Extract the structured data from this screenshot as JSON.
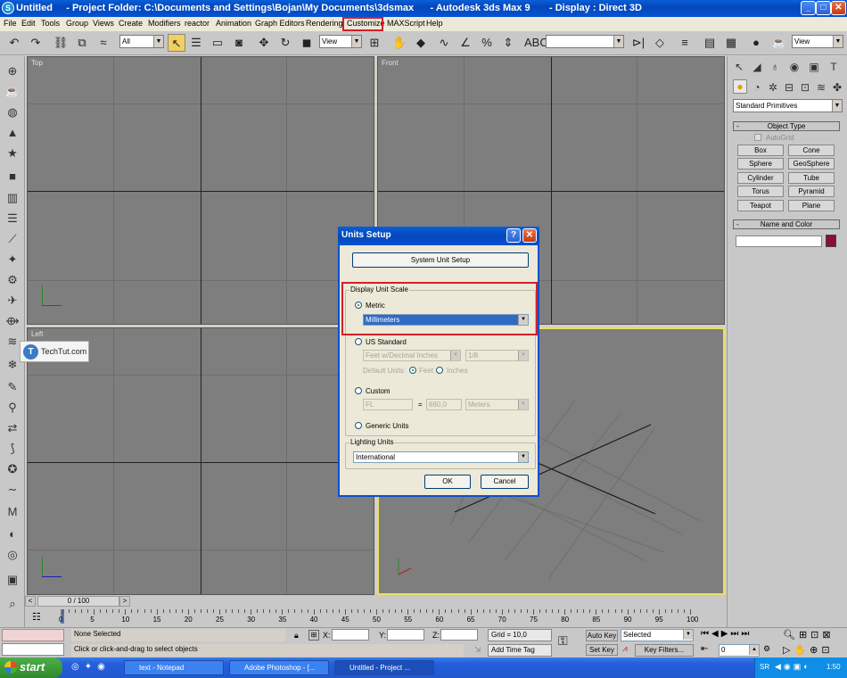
{
  "window": {
    "title": "Untitled     - Project Folder: C:\\Documents and Settings\\Bojan\\My Documents\\3dsmax      - Autodesk 3ds Max 9       - Display : Direct 3D",
    "controls": [
      "_",
      "□",
      "✕"
    ]
  },
  "menu": {
    "items": [
      "File",
      "Edit",
      "Tools",
      "Group",
      "Views",
      "Create",
      "Modifiers",
      "reactor",
      "Animation",
      "Graph Editors",
      "Rendering",
      "Customize",
      "MAXScript",
      "Help"
    ],
    "highlighted": "Customize"
  },
  "toolbar": {
    "selection_filter": "All",
    "ref_coord": "View",
    "named_sel": "",
    "view_right": "View"
  },
  "viewports": {
    "top": "Top",
    "front": "Front",
    "left": "Left",
    "perspective": "Perspective"
  },
  "watermark": {
    "text": "TechTut.com"
  },
  "command_panel": {
    "category": "Standard Primitives",
    "object_type_title": "Object Type",
    "autogrid": "AutoGrid",
    "buttons": [
      "Box",
      "Cone",
      "Sphere",
      "GeoSphere",
      "Cylinder",
      "Tube",
      "Torus",
      "Pyramid",
      "Teapot",
      "Plane"
    ],
    "name_color_title": "Name and Color",
    "swatch_color": "#8b1030"
  },
  "timeline": {
    "frame": "0 / 100",
    "ticks": [
      "0",
      "5",
      "10",
      "15",
      "20",
      "25",
      "30",
      "35",
      "40",
      "45",
      "50",
      "55",
      "60",
      "65",
      "70",
      "75",
      "80",
      "85",
      "90",
      "95",
      "100"
    ]
  },
  "status": {
    "selection": "None Selected",
    "prompt": "Click or click-and-drag to select objects",
    "x_label": "X:",
    "y_label": "Y:",
    "z_label": "Z:",
    "grid": "Grid = 10,0",
    "add_time_tag": "Add Time Tag",
    "auto_key": "Auto Key",
    "set_key": "Set Key",
    "selected": "Selected",
    "key_filters": "Key Filters...",
    "frame_field": "0"
  },
  "dialog": {
    "title": "Units Setup",
    "system_unit_setup": "System Unit Setup",
    "display_unit_scale": "Display Unit Scale",
    "metric": "Metric",
    "metric_value": "Millimeters",
    "us_standard": "US Standard",
    "us_value": "Feet w/Decimal Inches",
    "us_fraction": "1/8",
    "default_units": "Default Units:",
    "feet": "Feet",
    "inches": "Inches",
    "custom": "Custom",
    "custom_name": "FL",
    "custom_eq": "=",
    "custom_value": "660,0",
    "custom_units": "Meters",
    "generic_units": "Generic Units",
    "lighting_units": "Lighting Units",
    "lighting_value": "International",
    "ok": "OK",
    "cancel": "Cancel"
  },
  "taskbar": {
    "start": "start",
    "tasks": [
      "text - Notepad",
      "Adobe Photoshop - [...",
      "Untitled     - Project ..."
    ],
    "lang": "SR",
    "time": "1:50"
  }
}
